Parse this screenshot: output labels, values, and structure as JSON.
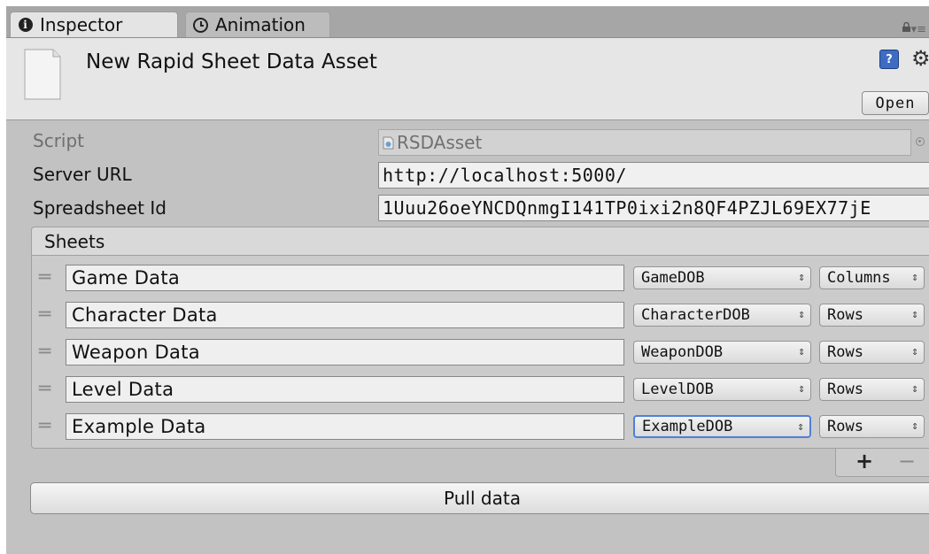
{
  "tabs": {
    "inspector": {
      "label": "Inspector",
      "icon": "info-icon"
    },
    "animation": {
      "label": "Animation",
      "icon": "clock-icon"
    }
  },
  "header": {
    "title": "New Rapid Sheet Data Asset",
    "open_label": "Open",
    "help_glyph": "?",
    "gear_glyph": "⚙"
  },
  "properties": {
    "script": {
      "label": "Script",
      "value": "RSDAsset"
    },
    "server_url": {
      "label": "Server URL",
      "value": "http://localhost:5000/"
    },
    "spreadsheet_id": {
      "label": "Spreadsheet Id",
      "value": "1Uuu26oeYNCDQnmgI141TP0ixi2n8QF4PZJL69EX77jE"
    }
  },
  "sheets": {
    "header": "Sheets",
    "handle_glyph": "═",
    "arrow_glyph": "⇕",
    "rows": [
      {
        "name": "Game Data",
        "class": "GameDOB",
        "mode": "Columns"
      },
      {
        "name": "Character Data",
        "class": "CharacterDOB",
        "mode": "Rows"
      },
      {
        "name": "Weapon Data",
        "class": "WeaponDOB",
        "mode": "Rows"
      },
      {
        "name": "Level Data",
        "class": "LevelDOB",
        "mode": "Rows"
      },
      {
        "name": "Example Data",
        "class": "ExampleDOB",
        "mode": "Rows"
      }
    ],
    "add_label": "+",
    "remove_label": "−"
  },
  "actions": {
    "pull_label": "Pull data"
  },
  "colors": {
    "panel": "#c2c2c2",
    "focus": "#4f7fd8"
  }
}
